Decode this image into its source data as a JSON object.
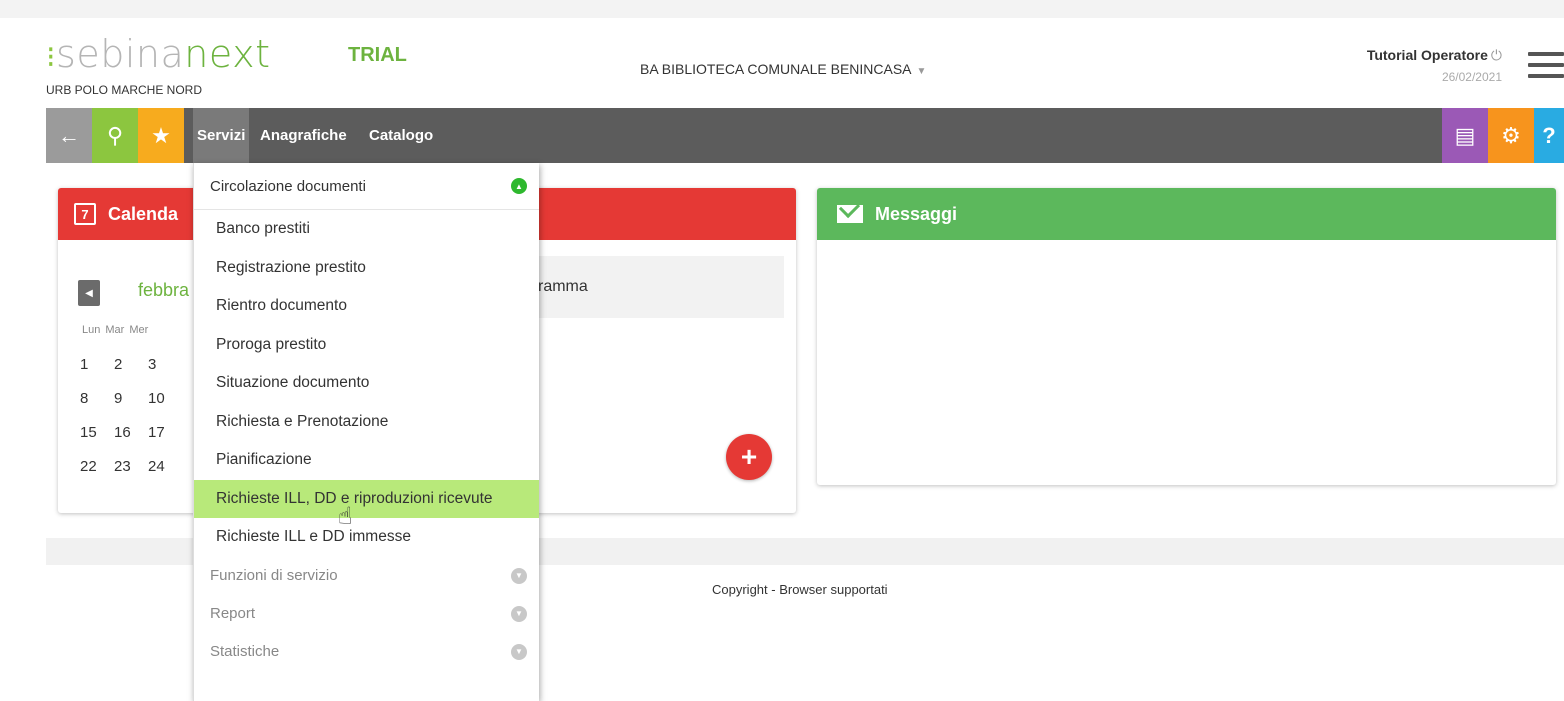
{
  "header": {
    "logo_part1": "sebina",
    "logo_part2": "next",
    "logo_dots": "⁝",
    "trial": "TRIAL",
    "polo": "URB POLO MARCHE NORD",
    "library": "BA BIBLIOTECA COMUNALE BENINCASA",
    "library_caret": "▼",
    "user_name": "Tutorial Operatore",
    "power_symbol": "⏻",
    "date": "26/02/2021"
  },
  "toolbar": {
    "back_icon": "←",
    "search_icon": "⚲",
    "star_icon": "★",
    "menus": [
      "Servizi",
      "Anagrafiche",
      "Catalogo"
    ],
    "report_icon": "▤",
    "gear_icon": "⚙",
    "help_icon": "?"
  },
  "calendar": {
    "title": "Calenda",
    "icon_day": "7",
    "nav_icon": "◀",
    "month": "febbra",
    "days": [
      "Lun",
      "Mar",
      "Mer"
    ],
    "weeks": [
      [
        "1",
        "2",
        "3"
      ],
      [
        "8",
        "9",
        "10"
      ],
      [
        "15",
        "16",
        "17"
      ],
      [
        "22",
        "23",
        "24"
      ]
    ],
    "program_text": "ramma",
    "add_icon": "+"
  },
  "messages": {
    "title": "Messaggi"
  },
  "footer": {
    "copyright": "Copyright - Browser supportati"
  },
  "dropdown": {
    "section_open": "Circolazione documenti",
    "items": [
      "Banco prestiti",
      "Registrazione prestito",
      "Rientro documento",
      "Proroga prestito",
      "Situazione documento",
      "Richiesta e Prenotazione",
      "Pianificazione",
      "Richieste ILL, DD e riproduzioni ricevute",
      "Richieste ILL e DD immesse"
    ],
    "highlighted_index": 7,
    "collapsed_sections": [
      "Funzioni di servizio",
      "Report",
      "Statistiche"
    ],
    "toggle_up": "▲",
    "toggle_down": "▼"
  },
  "colors": {
    "accent_green": "#6db33f",
    "calendar_red": "#e53935",
    "messages_green": "#5cb85c",
    "highlight": "#b8e97a"
  }
}
